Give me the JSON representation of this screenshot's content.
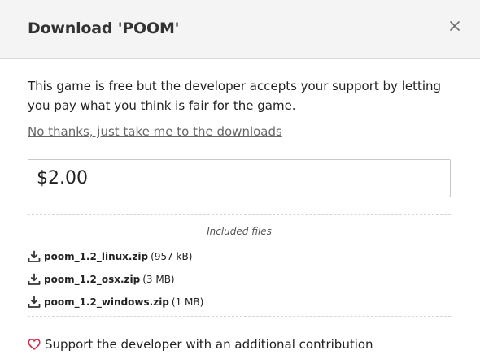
{
  "dialog": {
    "title": "Download 'POOM'",
    "close_icon": "close-icon"
  },
  "intro": {
    "text": "This game is free but the developer accepts your support by letting you pay what you think is fair for the game.",
    "skip_link": "No thanks, just take me to the downloads"
  },
  "price": {
    "value": "$2.00"
  },
  "files": {
    "heading": "Included files",
    "icon": "download-icon",
    "items": [
      {
        "name": "poom_1.2_linux.zip",
        "size": "(957 kB)"
      },
      {
        "name": "poom_1.2_osx.zip",
        "size": "(3 MB)"
      },
      {
        "name": "poom_1.2_windows.zip",
        "size": "(1 MB)"
      }
    ]
  },
  "support": {
    "icon": "heart-icon",
    "label": "Support the developer with an additional contribution",
    "heart_color": "#da2c4d"
  }
}
